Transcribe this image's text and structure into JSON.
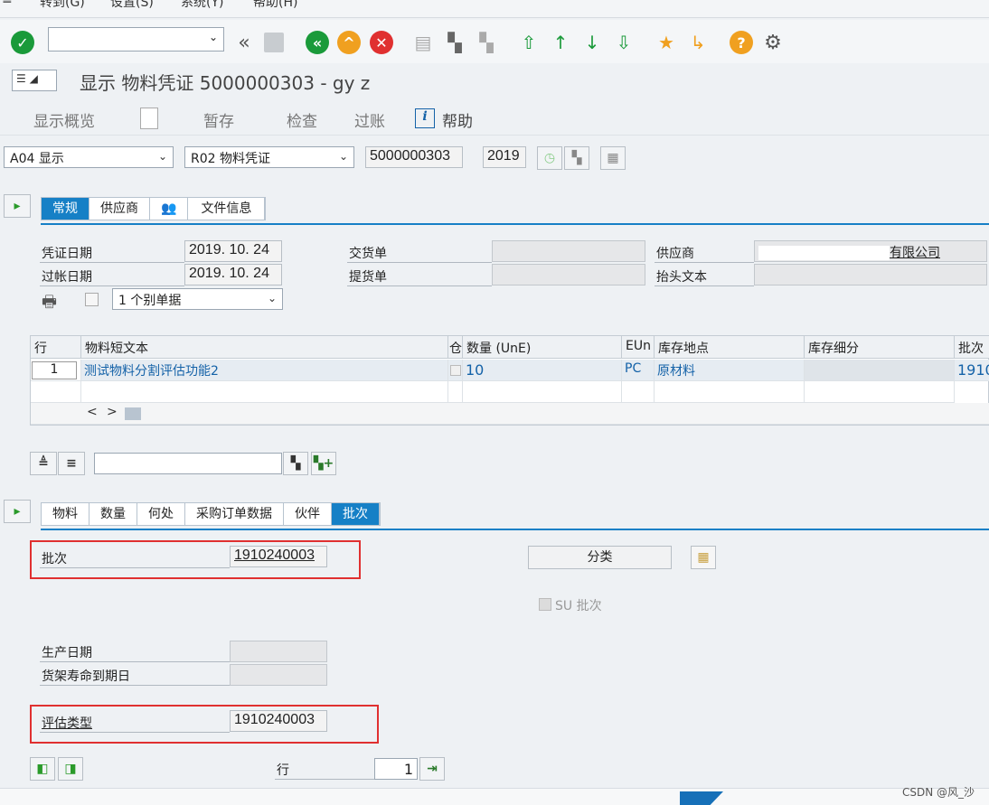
{
  "menu": [
    "设置(S)",
    "系统(Y)",
    "帮助(H)"
  ],
  "menu_cut": "转到(G)",
  "title": "显示 物料凭证 5000000303 - gy z",
  "app_toolbar": {
    "overview": "显示概览",
    "hold": "暂存",
    "check": "检查",
    "post": "过账",
    "help": "帮助"
  },
  "selector": {
    "action": "A04 显示",
    "ref": "R02 物料凭证",
    "doc_no": "5000000303",
    "year": "2019"
  },
  "header_tabs": [
    "常规",
    "供应商",
    "",
    "文件信息"
  ],
  "header_fields": {
    "doc_date_label": "凭证日期",
    "doc_date": "2019. 10. 24",
    "post_date_label": "过帐日期",
    "post_date": "2019. 10. 24",
    "delivery_note_label": "交货单",
    "bill_of_lading_label": "提货单",
    "vendor_label": "供应商",
    "vendor_value": "有限公司",
    "header_text_label": "抬头文本",
    "print_option": "1 个别单据"
  },
  "table": {
    "headers": [
      "行",
      "物料短文本",
      "仓",
      "数量 (UnE)",
      "EUn",
      "库存地点",
      "库存细分",
      "批次"
    ],
    "rows": [
      {
        "line": "1",
        "text": "测试物料分割评估功能2",
        "qty": "10",
        "unit": "PC",
        "sloc": "原材料",
        "stock": "",
        "batch": "1910"
      }
    ]
  },
  "item_tabs": [
    "物料",
    "数量",
    "何处",
    "采购订单数据",
    "伙伴",
    "批次"
  ],
  "batch_section": {
    "batch_label": "批次",
    "batch_value": "1910240003",
    "classify_button": "分类",
    "su_batch_label": "SU 批次",
    "prod_date_label": "生产日期",
    "shelf_life_label": "货架寿命到期日",
    "valuation_label": "评估类型",
    "valuation_value": "1910240003"
  },
  "footer": {
    "line_label": "行",
    "line_value": "1",
    "watermark": "CSDN @风_沙"
  },
  "colors": {
    "accent": "#1680c6",
    "green": "#1a9a3a",
    "red": "#e03030",
    "orange": "#f0a020"
  }
}
